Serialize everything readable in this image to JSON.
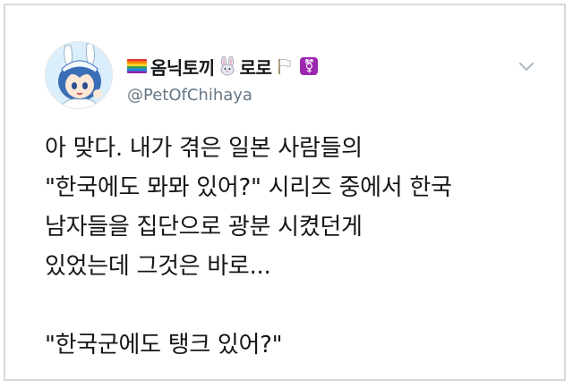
{
  "tweet": {
    "display_name": "옴닉토끼",
    "display_name_suffix": "로로",
    "handle": "@PetOfChihaya",
    "name_emojis": [
      "rainbow-flag-icon",
      "rabbit-face-icon",
      "white-flag-icon",
      "transgender-symbol-icon"
    ],
    "trans_symbol": "⚧",
    "body_lines": [
      "아 맞다. 내가 겪은 일본 사람들의",
      "\"한국에도 뫄뫄 있어?\" 시리즈 중에서 한국",
      "남자들을 집단으로 광분 시켰던게",
      "있었는데 그것은 바로...",
      "\"한국군에도 탱크 있어?\""
    ]
  },
  "colors": {
    "text": "#14171a",
    "handle": "#657786",
    "trans_badge": "#9c27b0",
    "frame_border": "#d8d8d8"
  }
}
